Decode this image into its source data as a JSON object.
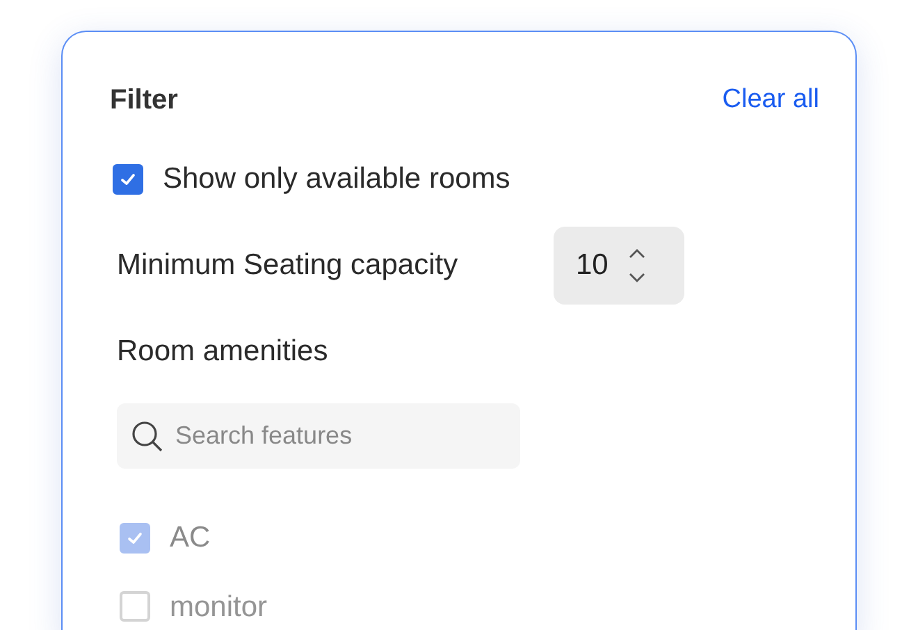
{
  "header": {
    "title": "Filter",
    "clear_link": "Clear all"
  },
  "available_only": {
    "label": "Show only available rooms",
    "checked": true
  },
  "seating": {
    "label": "Minimum Seating capacity",
    "value": "10"
  },
  "amenities": {
    "title": "Room amenities",
    "search": {
      "placeholder": "Search features"
    },
    "items": [
      {
        "label": "AC",
        "checked": true
      },
      {
        "label": "monitor",
        "checked": false
      }
    ]
  }
}
